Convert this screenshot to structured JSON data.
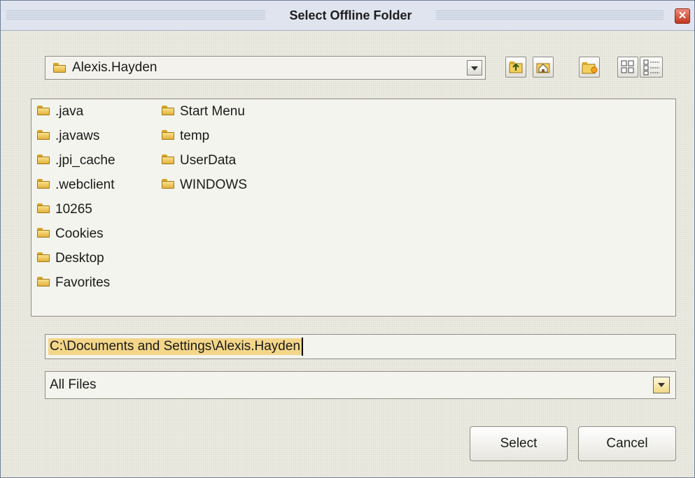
{
  "window": {
    "title": "Select Offline Folder",
    "close_glyph": "✕"
  },
  "lookin": {
    "selected": "Alexis.Hayden",
    "icon": "folder-icon"
  },
  "toolbar": {
    "buttons": [
      {
        "name": "up-one-level-icon"
      },
      {
        "name": "home-icon"
      },
      {
        "name": "new-folder-icon"
      },
      {
        "name": "list-view-icon"
      },
      {
        "name": "details-view-icon"
      }
    ]
  },
  "files": {
    "column1": [
      ".java",
      ".javaws",
      ".jpi_cache",
      ".webclient",
      "10265",
      "Cookies",
      "Desktop",
      "Favorites"
    ],
    "column2": [
      "Start Menu",
      "temp",
      "UserData",
      "WINDOWS"
    ]
  },
  "path": {
    "value": "C:\\Documents and Settings\\Alexis.Hayden"
  },
  "filter": {
    "selected": "All Files"
  },
  "buttons": {
    "select": "Select",
    "cancel": "Cancel"
  },
  "colors": {
    "highlight": "#f3d689",
    "close": "#c2361f"
  }
}
